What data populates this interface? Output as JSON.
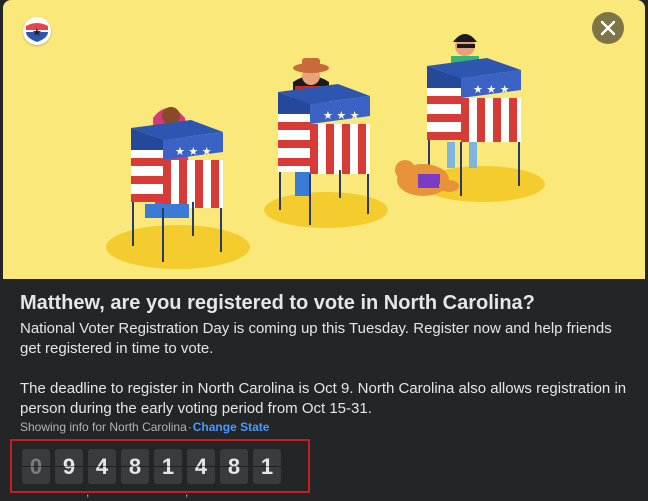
{
  "dialog": {
    "title": "Matthew, are you registered to vote in North Carolina?",
    "paragraph1": "National Voter Registration Day is coming up this Tuesday. Register now and help friends get registered in time to vote.",
    "paragraph2": "The deadline to register in North Carolina is Oct 9. North Carolina also allows registration in person during the early voting period from Oct 15-31.",
    "showing_info": "Showing info for North Carolina",
    "separator": "·",
    "change_state_label": "Change State"
  },
  "counter": {
    "digits": [
      "0",
      "9",
      "4",
      "8",
      "1",
      "4",
      "8",
      "1"
    ],
    "separators": [
      ",",
      ","
    ]
  },
  "colors": {
    "hero_bg": "#fae97a",
    "accent_link": "#4599ff",
    "highlight_border": "#c41f1f",
    "booth_blue": "#3a63c4",
    "booth_red": "#d83a36"
  },
  "icons": {
    "close": "close-icon",
    "badge": "vote-badge-icon"
  }
}
